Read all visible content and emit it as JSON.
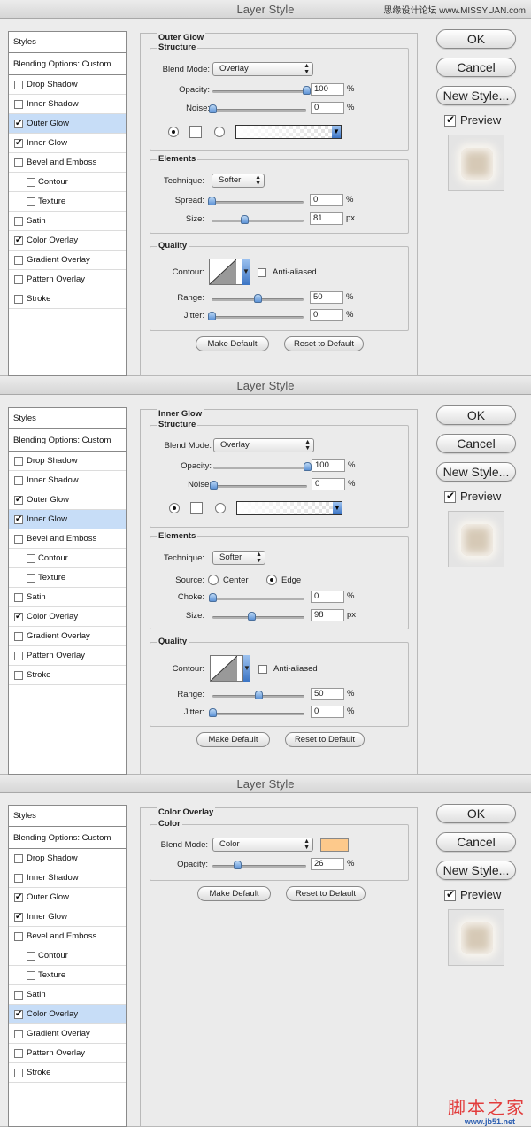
{
  "watermark": "思缘设计论坛 www.MISSYUAN.com",
  "bottom_logo": "脚本之家",
  "bottom_url": "www.jb51.net",
  "dialogs": [
    {
      "title": "Layer Style",
      "panel_title": "Outer Glow",
      "buttons": {
        "ok": "OK",
        "cancel": "Cancel",
        "new_style": "New Style...",
        "preview": "Preview"
      },
      "sidebar": {
        "header": "Styles",
        "blending": "Blending Options: Custom",
        "items": [
          "Drop Shadow",
          "Inner Shadow",
          "Outer Glow",
          "Inner Glow",
          "Bevel and Emboss",
          "Contour",
          "Texture",
          "Satin",
          "Color Overlay",
          "Gradient Overlay",
          "Pattern Overlay",
          "Stroke"
        ],
        "checked": [
          false,
          false,
          true,
          true,
          false,
          false,
          false,
          false,
          true,
          false,
          false,
          false
        ],
        "selected": "Outer Glow"
      },
      "structure": {
        "title": "Structure",
        "blend_label": "Blend Mode:",
        "blend_mode": "Overlay",
        "opacity_label": "Opacity:",
        "opacity": "100",
        "noise_label": "Noise:",
        "noise": "0",
        "unit": "%"
      },
      "elements": {
        "title": "Elements",
        "technique_label": "Technique:",
        "technique": "Softer",
        "spread_label": "Spread:",
        "spread": "0",
        "spread_unit": "%",
        "size_label": "Size:",
        "size": "81",
        "size_unit": "px"
      },
      "quality": {
        "title": "Quality",
        "contour_label": "Contour:",
        "anti_aliased": "Anti-aliased",
        "range_label": "Range:",
        "range": "50",
        "jitter_label": "Jitter:",
        "jitter": "0",
        "unit": "%"
      },
      "make_default": "Make Default",
      "reset_default": "Reset to Default"
    },
    {
      "title": "Layer Style",
      "panel_title": "Inner Glow",
      "buttons": {
        "ok": "OK",
        "cancel": "Cancel",
        "new_style": "New Style...",
        "preview": "Preview"
      },
      "sidebar": {
        "header": "Styles",
        "blending": "Blending Options: Custom",
        "items": [
          "Drop Shadow",
          "Inner Shadow",
          "Outer Glow",
          "Inner Glow",
          "Bevel and Emboss",
          "Contour",
          "Texture",
          "Satin",
          "Color Overlay",
          "Gradient Overlay",
          "Pattern Overlay",
          "Stroke"
        ],
        "checked": [
          false,
          false,
          true,
          true,
          false,
          false,
          false,
          false,
          true,
          false,
          false,
          false
        ],
        "selected": "Inner Glow"
      },
      "structure": {
        "title": "Structure",
        "blend_label": "Blend Mode:",
        "blend_mode": "Overlay",
        "opacity_label": "Opacity:",
        "opacity": "100",
        "noise_label": "Noise:",
        "noise": "0",
        "unit": "%"
      },
      "elements": {
        "title": "Elements",
        "technique_label": "Technique:",
        "technique": "Softer",
        "source_label": "Source:",
        "source_center": "Center",
        "source_edge": "Edge",
        "choke_label": "Choke:",
        "choke": "0",
        "choke_unit": "%",
        "size_label": "Size:",
        "size": "98",
        "size_unit": "px"
      },
      "quality": {
        "title": "Quality",
        "contour_label": "Contour:",
        "anti_aliased": "Anti-aliased",
        "range_label": "Range:",
        "range": "50",
        "jitter_label": "Jitter:",
        "jitter": "0",
        "unit": "%"
      },
      "make_default": "Make Default",
      "reset_default": "Reset to Default"
    },
    {
      "title": "Layer Style",
      "panel_title": "Color Overlay",
      "buttons": {
        "ok": "OK",
        "cancel": "Cancel",
        "new_style": "New Style...",
        "preview": "Preview"
      },
      "sidebar": {
        "header": "Styles",
        "blending": "Blending Options: Custom",
        "items": [
          "Drop Shadow",
          "Inner Shadow",
          "Outer Glow",
          "Inner Glow",
          "Bevel and Emboss",
          "Contour",
          "Texture",
          "Satin",
          "Color Overlay",
          "Gradient Overlay",
          "Pattern Overlay",
          "Stroke"
        ],
        "checked": [
          false,
          false,
          true,
          true,
          false,
          false,
          false,
          false,
          true,
          false,
          false,
          false
        ],
        "selected": "Color Overlay"
      },
      "color": {
        "title": "Color",
        "blend_label": "Blend Mode:",
        "blend_mode": "Color",
        "swatch_color": "#fdc98b",
        "opacity_label": "Opacity:",
        "opacity": "26",
        "unit": "%"
      },
      "make_default": "Make Default",
      "reset_default": "Reset to Default"
    }
  ]
}
